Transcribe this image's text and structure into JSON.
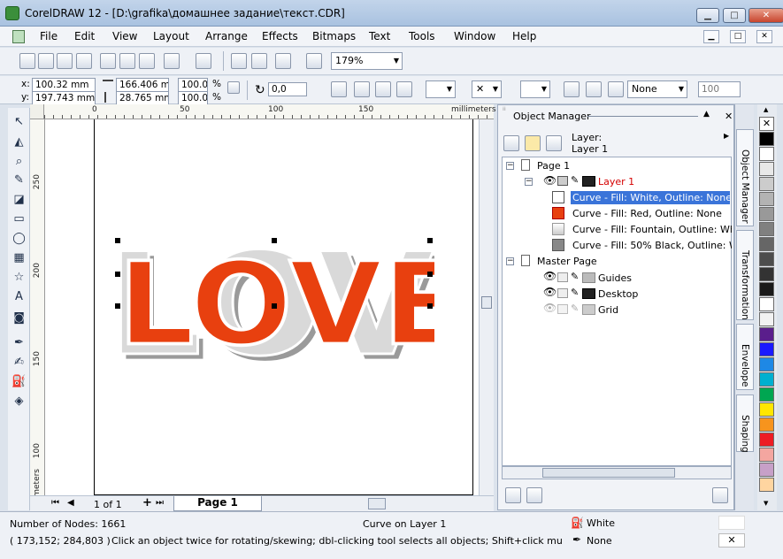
{
  "window": {
    "title": "CorelDRAW 12 - [D:\\grafika\\домашнее задание\\текст.CDR]",
    "controls": [
      "▁",
      "□",
      "✕"
    ]
  },
  "menu": [
    "File",
    "Edit",
    "View",
    "Layout",
    "Arrange",
    "Effects",
    "Bitmaps",
    "Text",
    "Tools",
    "Window",
    "Help"
  ],
  "standard_toolbar": {
    "zoom": "179%"
  },
  "property_bar": {
    "x": "100.32 mm",
    "y": "197.743 mm",
    "width": "166.406 mr",
    "height": "28.765 mm",
    "scale_x": "100.0",
    "scale_y": "100.0",
    "percent": "%",
    "rotation": "0,0",
    "outline_width": "None",
    "outline_scale": "100"
  },
  "rulers": {
    "unit": "millimeters",
    "h_ticks": [
      "0",
      "50",
      "100",
      "150"
    ],
    "v_ticks": [
      "250",
      "200",
      "150",
      "100"
    ]
  },
  "artwork": {
    "word": "LOVE"
  },
  "page_nav": {
    "current": "1 of 1",
    "tab": "Page 1"
  },
  "docker": {
    "title": "Object Manager",
    "layer_label": "Layer:",
    "layer_name": "Layer 1",
    "tree": {
      "page": "Page 1",
      "layer": "Layer 1",
      "objects": [
        "Curve - Fill: White, Outline: None",
        "Curve - Fill: Red, Outline: None",
        "Curve - Fill: Fountain, Outline: Wh",
        "Curve - Fill: 50% Black, Outline: Wl"
      ],
      "master": "Master Page",
      "master_layers": [
        "Guides",
        "Desktop",
        "Grid"
      ]
    },
    "side_tabs": [
      "Object Manager",
      "Transformation",
      "Envelope",
      "Shaping"
    ]
  },
  "palette": [
    "#ffffff",
    "#000000",
    "#ffffff",
    "#e8e8e8",
    "#cccccc",
    "#b3b3b3",
    "#999999",
    "#808080",
    "#666666",
    "#4d4d4d",
    "#333333",
    "#1a1a1a",
    "#ffffff",
    "#f2f2f2",
    "#5a1e8c",
    "#1a1aff",
    "#1e88e5",
    "#00b0d0",
    "#00a651",
    "#ffe600",
    "#f7941d",
    "#ed1c24",
    "#f4a6a0",
    "#c7a0c8",
    "#ffd5a0"
  ],
  "status": {
    "nodes": "Number of Nodes: 1661",
    "layer": "Curve on Layer 1",
    "fill": "White",
    "coords": "( 173,152; 284,803 )",
    "hint": "Click an object twice for rotating/skewing; dbl-clicking tool selects all objects; Shift+click multi-selects; Alt...",
    "outline": "None"
  }
}
